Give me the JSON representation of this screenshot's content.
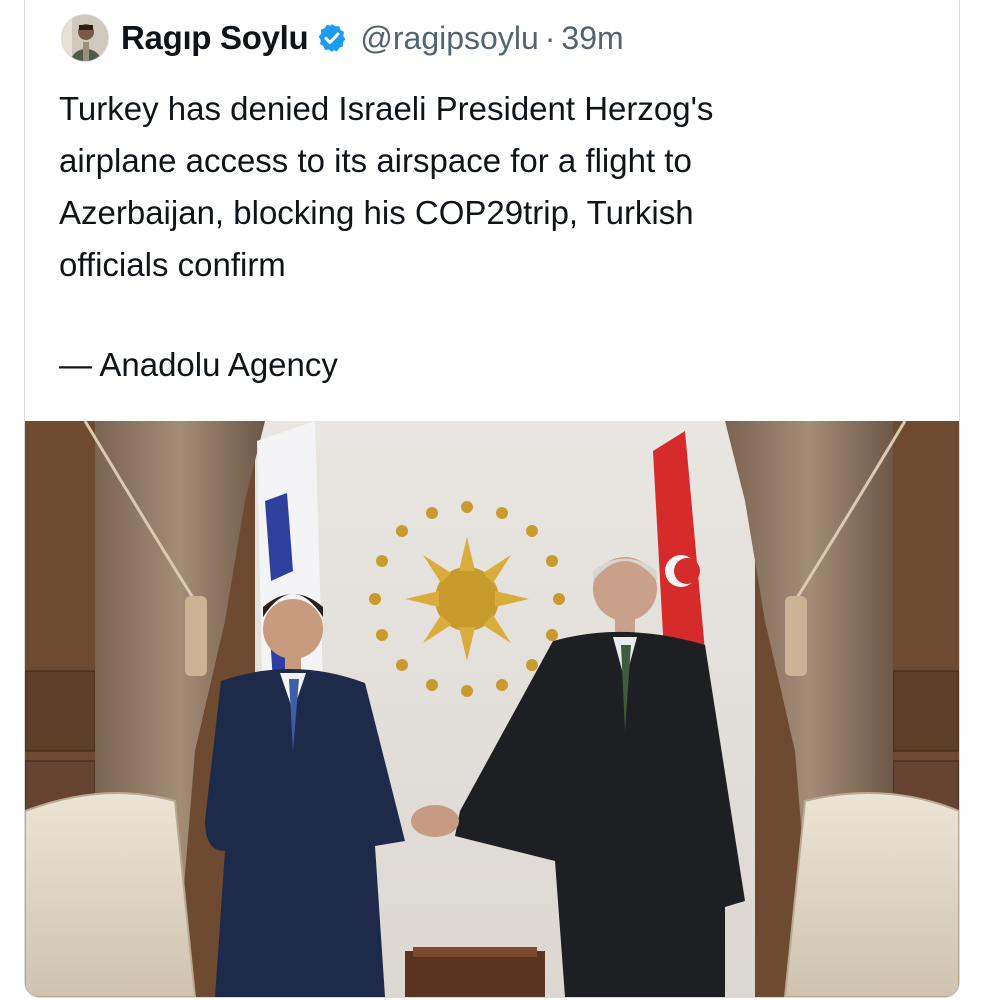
{
  "tweet": {
    "author_name": "Ragıp Soylu",
    "handle": "@ragipsoylu",
    "separator": "·",
    "time": "39m",
    "text": "Turkey has denied Israeli President Herzog's\nairplane access to its airspace for a flight to\nAzerbaijan, blocking his COP29trip, Turkish\nofficials confirm",
    "source": "— Anadolu Agency"
  },
  "icons": {
    "verified": "verified-badge-icon",
    "avatar": "avatar"
  },
  "colors": {
    "verified_blue": "#1d9bf0",
    "handle_gray": "#536471",
    "text": "#0f1419"
  }
}
